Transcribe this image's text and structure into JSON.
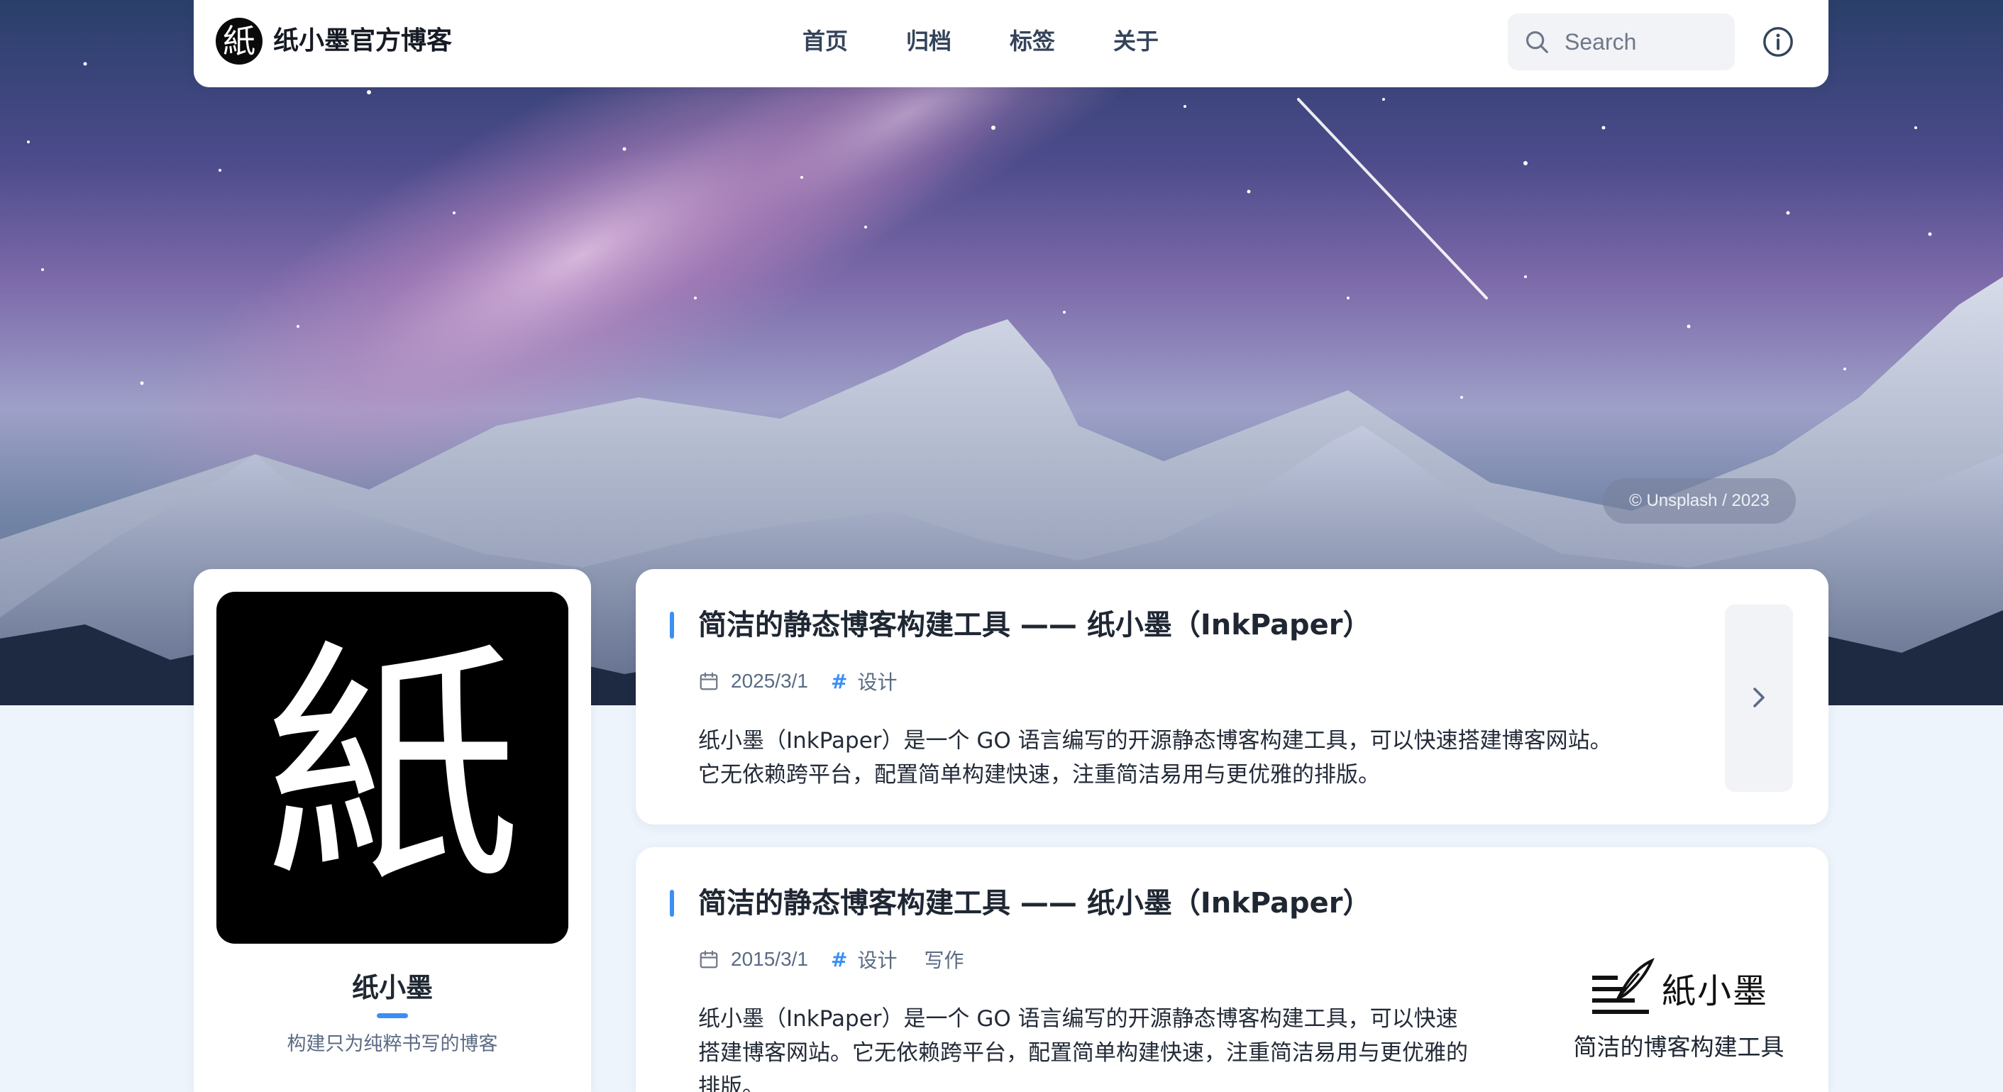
{
  "colors": {
    "accent": "#3b8ff3",
    "page_background": "#eef4fc",
    "card_background": "#ffffff"
  },
  "header": {
    "logo_char": "紙",
    "site_title": "纸小墨官方博客",
    "nav": [
      "首页",
      "归档",
      "标签",
      "关于"
    ],
    "search_placeholder": "Search",
    "icons": {
      "search": "search-icon",
      "info": "info-icon"
    }
  },
  "hero": {
    "credit": "© Unsplash / 2023"
  },
  "profile": {
    "avatar_char": "紙",
    "name": "纸小墨",
    "bio": "构建只为纯粹书写的博客"
  },
  "posts": [
    {
      "title": "简洁的静态博客构建工具 —— 纸小墨（InkPaper）",
      "date": "2025/3/1",
      "tags": [
        "设计"
      ],
      "excerpt": "纸小墨（InkPaper）是一个 GO 语言编写的开源静态博客构建工具，可以快速搭建博客网站。它无依赖跨平台，配置简单构建快速，注重简洁易用与更优雅的排版。",
      "icons": {
        "date": "calendar-icon",
        "next": "chevron-right-icon"
      }
    },
    {
      "title": "简洁的静态博客构建工具 —— 纸小墨（InkPaper）",
      "date": "2015/3/1",
      "tags": [
        "设计",
        "写作"
      ],
      "excerpt": "纸小墨（InkPaper）是一个 GO 语言编写的开源静态博客构建工具，可以快速搭建博客网站。它无依赖跨平台，配置简单构建快速，注重简洁易用与更优雅的排版。",
      "thumbnail": {
        "logo_text": "紙小墨",
        "caption": "简洁的博客构建工具"
      }
    }
  ]
}
